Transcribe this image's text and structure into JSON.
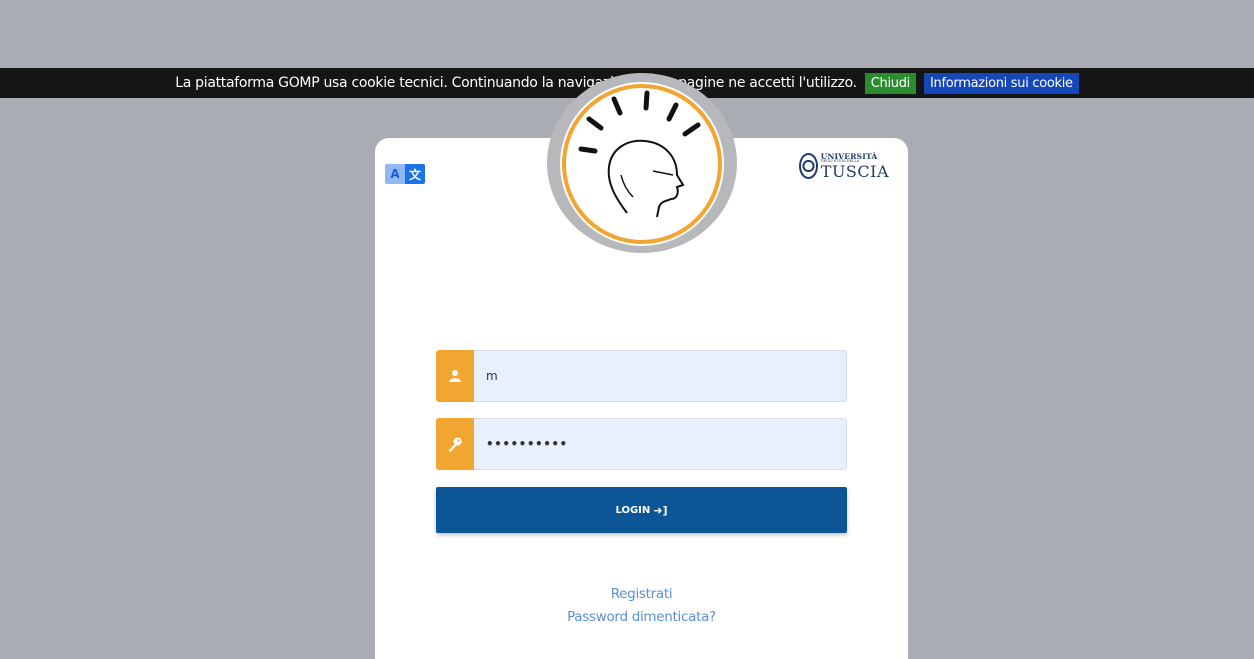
{
  "cookie_bar": {
    "text": "La piattaforma GOMP usa cookie tecnici. Continuando la navigazione sulle pagine ne accetti l'utilizzo.",
    "close_label": "Chiudi",
    "info_label": "Informazioni sui cookie"
  },
  "translate": {
    "left_glyph": "A",
    "right_glyph": "文"
  },
  "university": {
    "line1": "UNIVERSITÀ",
    "line2": "DEGLI STUDI DELLA",
    "line3": "TUSCIA"
  },
  "form": {
    "username_value": "m",
    "password_value": "••••••••••",
    "login_label": "LOGIN",
    "login_icon": "sign-in-icon"
  },
  "links": {
    "register": "Registrati",
    "forgot_password": "Password dimenticata?"
  },
  "colors": {
    "cookie_bg": "#151515",
    "close_btn": "#2a8c2f",
    "info_btn": "#1447b8",
    "addon_orange": "#f2a530",
    "login_blue": "#0c5597",
    "link_blue": "#5b8fd6"
  }
}
